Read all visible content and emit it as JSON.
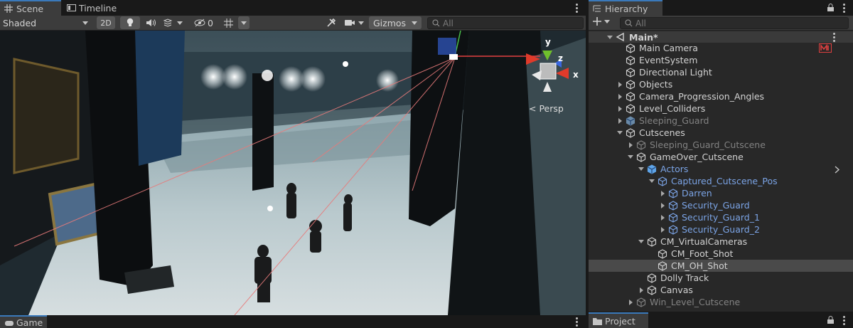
{
  "scene_window": {
    "tabs": [
      {
        "label": "Scene",
        "icon": "grid-icon"
      },
      {
        "label": "Timeline",
        "icon": "timeline-icon"
      }
    ],
    "toolbar": {
      "shading_mode": "Shaded",
      "mode_2d": "2D",
      "hidden_count": "0",
      "gizmos_label": "Gizmos",
      "search_placeholder": "All"
    },
    "viewport": {
      "projection_label": "< Persp",
      "gizmo_axes": [
        "y",
        "z",
        "x"
      ]
    }
  },
  "game_tab": {
    "label": "Game"
  },
  "hierarchy": {
    "tab_label": "Hierarchy",
    "search_placeholder": "All",
    "items": [
      {
        "label": "Main*",
        "depth": 0,
        "fold": "open",
        "kind": "scene"
      },
      {
        "label": "Main Camera",
        "depth": 1,
        "fold": "none",
        "kind": "normal",
        "badge": true
      },
      {
        "label": "EventSystem",
        "depth": 1,
        "fold": "none",
        "kind": "normal"
      },
      {
        "label": "Directional Light",
        "depth": 1,
        "fold": "none",
        "kind": "normal"
      },
      {
        "label": "Objects",
        "depth": 1,
        "fold": "closed",
        "kind": "normal"
      },
      {
        "label": "Camera_Progression_Angles",
        "depth": 1,
        "fold": "closed",
        "kind": "normal"
      },
      {
        "label": "Level_Colliders",
        "depth": 1,
        "fold": "closed",
        "kind": "normal"
      },
      {
        "label": "Sleeping_Guard",
        "depth": 1,
        "fold": "closed",
        "kind": "dim-prefab"
      },
      {
        "label": "Cutscenes",
        "depth": 1,
        "fold": "open",
        "kind": "normal"
      },
      {
        "label": "Sleeping_Guard_Cutscene",
        "depth": 2,
        "fold": "closed",
        "kind": "dim"
      },
      {
        "label": "GameOver_Cutscene",
        "depth": 2,
        "fold": "open",
        "kind": "normal"
      },
      {
        "label": "Actors",
        "depth": 3,
        "fold": "open",
        "kind": "prefab-root"
      },
      {
        "label": "Captured_Cutscene_Pos",
        "depth": 4,
        "fold": "open",
        "kind": "prefab"
      },
      {
        "label": "Darren",
        "depth": 5,
        "fold": "closed",
        "kind": "prefab"
      },
      {
        "label": "Security_Guard",
        "depth": 5,
        "fold": "closed",
        "kind": "prefab"
      },
      {
        "label": "Security_Guard_1",
        "depth": 5,
        "fold": "closed",
        "kind": "prefab"
      },
      {
        "label": "Security_Guard_2",
        "depth": 5,
        "fold": "closed",
        "kind": "prefab"
      },
      {
        "label": "CM_VirtualCameras",
        "depth": 3,
        "fold": "open",
        "kind": "normal"
      },
      {
        "label": "CM_Foot_Shot",
        "depth": 4,
        "fold": "none",
        "kind": "normal"
      },
      {
        "label": "CM_OH_Shot",
        "depth": 4,
        "fold": "none",
        "kind": "selected"
      },
      {
        "label": "Dolly Track",
        "depth": 3,
        "fold": "none",
        "kind": "normal"
      },
      {
        "label": "Canvas",
        "depth": 3,
        "fold": "closed",
        "kind": "normal"
      },
      {
        "label": "Win_Level_Cutscene",
        "depth": 2,
        "fold": "closed",
        "kind": "dim"
      }
    ]
  },
  "project_tab": {
    "label": "Project"
  },
  "colors": {
    "accent": "#3a79bb",
    "prefab_blue": "#7ba4e6",
    "panel_bg": "#282828",
    "toolbar_bg": "#3c3c3c"
  }
}
